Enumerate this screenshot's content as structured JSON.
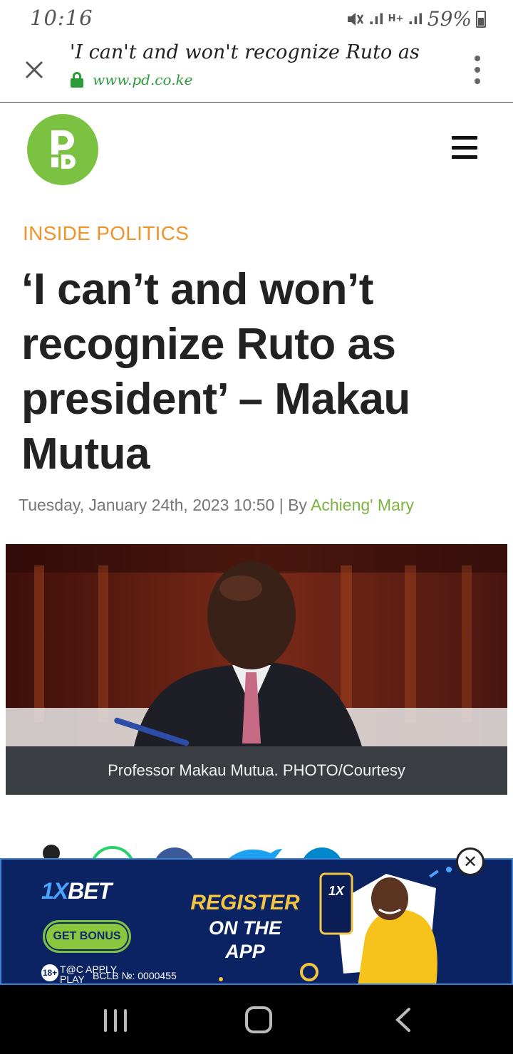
{
  "status_bar": {
    "time": "10:16",
    "network_1": ".ıl",
    "network_type": "H+",
    "network_2": ".ıl",
    "battery": "59%"
  },
  "browser": {
    "title": "'I can't and won't recognize Ruto as",
    "url": "www.pd.co.ke"
  },
  "article": {
    "category": "INSIDE POLITICS",
    "headline": "‘I can’t and won’t recognize Ruto as president’ – Makau Mutua",
    "date": "Tuesday, January 24th, 2023 10:50 | By",
    "author": "Achieng' Mary",
    "caption": "Professor Makau Mutua. PHOTO/Courtesy"
  },
  "ad": {
    "brand_a": "1X",
    "brand_b": "BET",
    "bonus_button": "GET BONUS",
    "register": "REGISTER",
    "on_the_app": "ON THE APP",
    "age": "18+",
    "terms": "T@C APPLY PLAY",
    "license": "BCLB №: 0000455",
    "phone_logo": "1X",
    "close": "✕"
  },
  "colors": {
    "brand_green": "#7cc242",
    "category_orange": "#f0932b",
    "author_green": "#7cb342",
    "ad_navy": "#0c2363",
    "ad_yellow": "#f4c542"
  }
}
